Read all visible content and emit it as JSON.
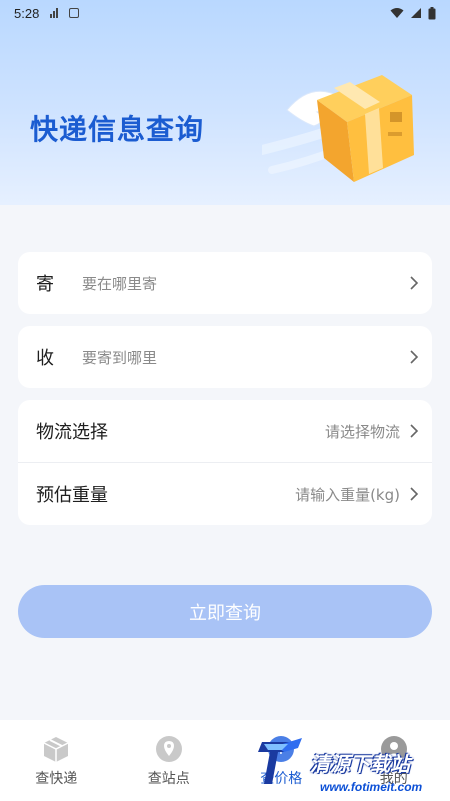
{
  "status_bar": {
    "time": "5:28"
  },
  "hero": {
    "title": "快递信息查询"
  },
  "sender": {
    "label": "寄",
    "placeholder": "要在哪里寄"
  },
  "receiver": {
    "label": "收",
    "placeholder": "要寄到哪里"
  },
  "logistics": {
    "label": "物流选择",
    "placeholder": "请选择物流"
  },
  "weight": {
    "label": "预估重量",
    "placeholder": "请输入重量(kg)"
  },
  "submit": {
    "label": "立即查询"
  },
  "tabs": [
    {
      "label": "查快递",
      "icon": "package-icon"
    },
    {
      "label": "查站点",
      "icon": "location-pin-icon"
    },
    {
      "label": "查价格",
      "icon": "price-icon",
      "active": true
    },
    {
      "label": "我的",
      "icon": "profile-icon"
    }
  ],
  "watermark": {
    "brand": "清源下载站",
    "url": "www.fotimeit.com"
  },
  "colors": {
    "accent": "#1b5cd1",
    "button": "#a9c3f6",
    "hero_top": "#b9d8ff"
  }
}
